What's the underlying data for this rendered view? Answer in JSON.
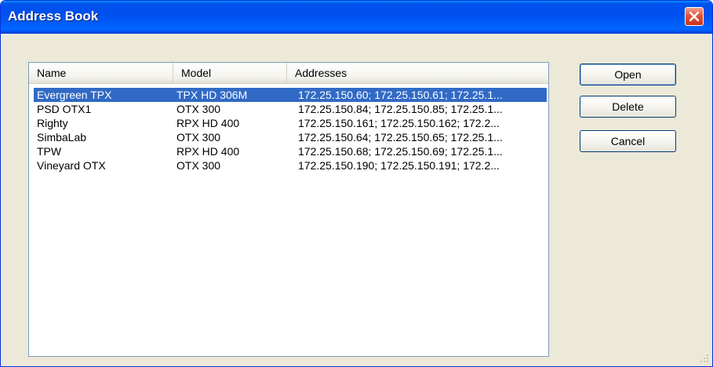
{
  "window": {
    "title": "Address Book"
  },
  "list": {
    "columns": [
      "Name",
      "Model",
      "Addresses"
    ],
    "rows": [
      {
        "name": "Evergreen TPX",
        "model": "TPX HD 306M",
        "addresses": "172.25.150.60; 172.25.150.61; 172.25.1...",
        "selected": true
      },
      {
        "name": "PSD OTX1",
        "model": "OTX 300",
        "addresses": "172.25.150.84; 172.25.150.85; 172.25.1...",
        "selected": false
      },
      {
        "name": "Righty",
        "model": "RPX HD 400",
        "addresses": "172.25.150.161; 172.25.150.162; 172.2...",
        "selected": false
      },
      {
        "name": "SimbaLab",
        "model": "OTX 300",
        "addresses": "172.25.150.64; 172.25.150.65; 172.25.1...",
        "selected": false
      },
      {
        "name": "TPW",
        "model": "RPX HD 400",
        "addresses": "172.25.150.68; 172.25.150.69; 172.25.1...",
        "selected": false
      },
      {
        "name": "Vineyard OTX",
        "model": "OTX 300",
        "addresses": "172.25.150.190; 172.25.150.191; 172.2...",
        "selected": false
      }
    ]
  },
  "buttons": {
    "open": "Open",
    "delete": "Delete",
    "cancel": "Cancel"
  },
  "colors": {
    "titlebar": "#0053ee",
    "selection": "#316ac5",
    "face": "#ece9d8"
  },
  "icons": {
    "close": "close-icon",
    "grip": "resize-grip-icon"
  }
}
